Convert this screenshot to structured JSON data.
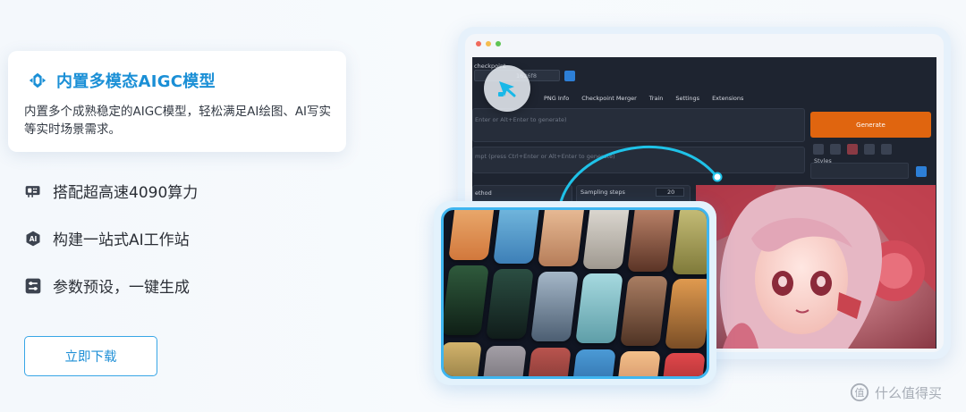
{
  "features": {
    "highlight": {
      "title": "内置多模态AIGC模型",
      "description": "内置多个成熟稳定的AIGC模型，轻松满足AI绘图、AI写实等实时场景需求。",
      "icon": "aigc-model-icon"
    },
    "items": [
      {
        "label": "搭配超高速4090算力",
        "icon": "gpu-icon"
      },
      {
        "label": "构建一站式AI工作站",
        "icon": "ai-hexagon-icon"
      },
      {
        "label": "参数预设，一键生成",
        "icon": "sliders-icon"
      }
    ]
  },
  "download_button": {
    "label": "立即下载"
  },
  "mockup": {
    "checkpoint_label": "checkpoint",
    "checkpoint_hash": "1626f8",
    "tabs": [
      "PNG Info",
      "Checkpoint Merger",
      "Train",
      "Settings",
      "Extensions"
    ],
    "prompt_placeholder": "Enter or Alt+Enter to generate)",
    "negative_placeholder": "mpt (press Ctrl+Enter or Alt+Enter to generate)",
    "generate_label": "Generate",
    "styles_label": "Styles",
    "method_label": "ethod",
    "sampling_steps_label": "Sampling steps",
    "sampling_steps_value": "20"
  },
  "watermark": {
    "text": "什么值得买"
  },
  "colors": {
    "accent": "#1a8fd6",
    "accent_border": "#38a6e6",
    "generate": "#e0650f",
    "gallery_border": "#3fb6f0"
  }
}
